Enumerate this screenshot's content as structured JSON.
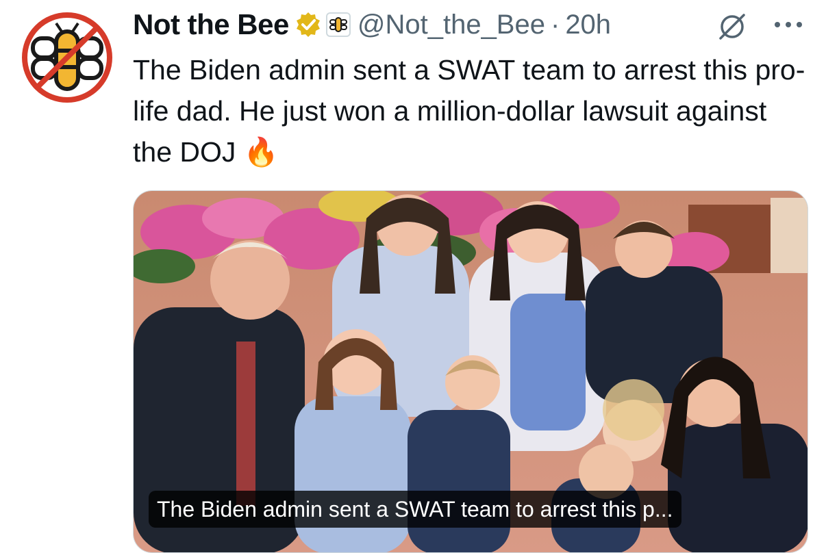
{
  "tweet": {
    "display_name": "Not the Bee",
    "handle": "@Not_the_Bee",
    "separator": "·",
    "time": "20h",
    "text": "The Biden admin sent a SWAT team to arrest this pro-life dad. He just won a million-dollar lawsuit against the DOJ 🔥",
    "verified_badge_color": "#e2b719",
    "media": {
      "caption": "The Biden admin sent a SWAT team to arrest this p..."
    }
  },
  "icons": {
    "avatar": "no-bee-logo-icon",
    "verified": "verified-badge-icon",
    "affiliate": "bee-affiliate-icon",
    "grok": "grok-icon",
    "more": "more-options-icon"
  },
  "colors": {
    "text": "#0f1419",
    "secondary": "#536471",
    "logo_red": "#d63b2a",
    "bee_yellow": "#f2b632"
  }
}
